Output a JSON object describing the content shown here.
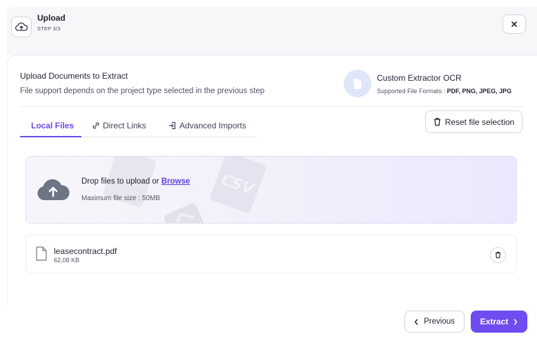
{
  "header": {
    "title": "Upload",
    "step": "STEP 3/3",
    "icon": "cloud-upload-icon",
    "close_label": "×"
  },
  "section": {
    "title": "Upload Documents to Extract",
    "subtitle": "File support depends on the project type selected in the previous step"
  },
  "extractor": {
    "name": "Custom Extractor OCR",
    "formats_label": "Supported File Formats : ",
    "formats": "PDF, PNG, JPEG, JPG",
    "icon": "document-icon"
  },
  "tabs": [
    {
      "label": "Local Files",
      "icon": "",
      "active": true
    },
    {
      "label": "Direct Links",
      "icon": "link-icon",
      "active": false
    },
    {
      "label": "Advanced Imports",
      "icon": "import-icon",
      "active": false
    }
  ],
  "reset_button": {
    "label": "Reset file selection",
    "icon": "trash-icon"
  },
  "dropzone": {
    "prompt": "Drop files to upload or ",
    "browse_label": "Browse",
    "max_size": "Maximum file size : 50MB",
    "watermark": "CSV"
  },
  "files": [
    {
      "name": "leasecontract.pdf",
      "size": "62,08 KB"
    }
  ],
  "footer": {
    "previous_label": "Previous",
    "extract_label": "Extract"
  },
  "colors": {
    "accent": "#6e4cf0",
    "tab_active": "#6a48e8",
    "link": "#5b3fe0"
  }
}
